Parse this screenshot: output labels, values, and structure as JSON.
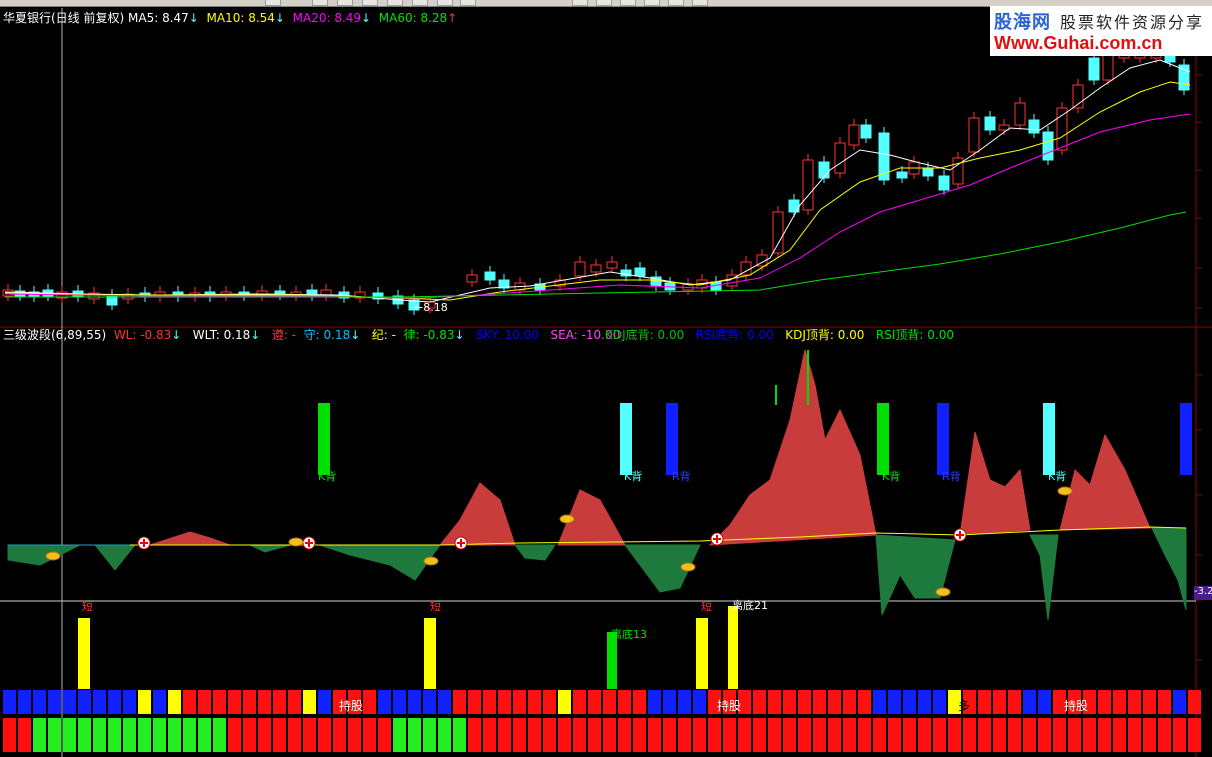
{
  "toolbar": {
    "buttons": 14
  },
  "logo": {
    "line1": "股海网",
    "line2": "股票软件资源分享",
    "line3": "Www.Guhai.com.cn"
  },
  "main_header": {
    "title": "华夏银行(日线 前复权)",
    "items": [
      {
        "label": "MA5: 8.47",
        "arrow": "↓",
        "color": "#ffffff"
      },
      {
        "label": "MA10: 8.54",
        "arrow": "↓",
        "color": "#ffff00"
      },
      {
        "label": "MA20: 8.49",
        "arrow": "↓",
        "color": "#ff00ff"
      },
      {
        "label": "MA60: 8.28",
        "arrow": "↑",
        "color": "#00e000"
      }
    ],
    "low_label": "8.18"
  },
  "indicator_header": {
    "title": "三级波段(6,89,55)",
    "items": [
      {
        "label": "WL: -0.83",
        "arrow": "↓",
        "color": "#ff3030"
      },
      {
        "label": "WLT: 0.18",
        "arrow": "↓",
        "color": "#ffffff"
      },
      {
        "label": "遵: -",
        "arrow": "",
        "color": "#ff3030"
      },
      {
        "label": "守: 0.18",
        "arrow": "↓",
        "color": "#00c0ff"
      },
      {
        "label": "纪: -",
        "arrow": "",
        "color": "#ffff00"
      },
      {
        "label": "律: -0.83",
        "arrow": "↓",
        "color": "#00e000"
      },
      {
        "label": "SKY: 10.00",
        "arrow": "",
        "color": "#0000ff"
      },
      {
        "label": "SEA: -10.00",
        "arrow": "",
        "color": "#ff40ff"
      },
      {
        "label": "KDJ底背: 0.00",
        "arrow": "",
        "color": "#00c000"
      },
      {
        "label": "RSI底背: 0.00",
        "arrow": "",
        "color": "#0000ff"
      },
      {
        "label": "KDJ顶背: 0.00",
        "arrow": "",
        "color": "#ffff00"
      },
      {
        "label": "RSI顶背: 0.00",
        "arrow": "",
        "color": "#00e000"
      }
    ],
    "value_badge": "-3.2"
  },
  "signals": {
    "short_labels": [
      "短",
      "短",
      "短"
    ],
    "bottom_labels": [
      "离底13",
      "离底21"
    ],
    "divergence_labels": [
      "K背",
      "K背",
      "R背",
      "K背",
      "R背",
      "K背"
    ],
    "hold_labels": [
      "持股",
      "持股",
      "持股",
      "多"
    ]
  },
  "colors": {
    "up": "#ff3333",
    "down": "#54ffff",
    "ma5": "#ffffff",
    "ma10": "#ffff00",
    "ma20": "#ff00ff",
    "ma60": "#00e000"
  }
}
